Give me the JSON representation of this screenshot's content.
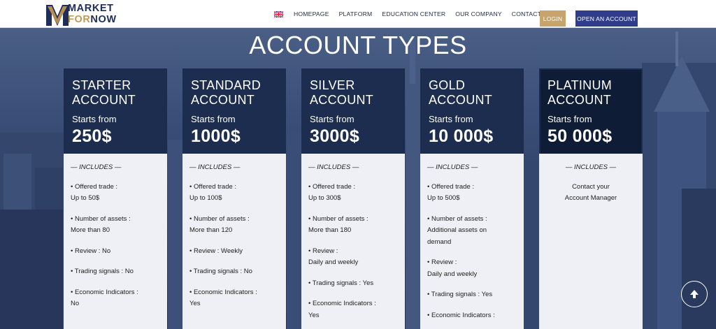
{
  "brand": {
    "line1": "MARKET",
    "line2_a": "FOR",
    "line2_b": "NOW",
    "colors": {
      "navy": "#1f2d5a",
      "gold": "#c49a50"
    }
  },
  "nav": {
    "language_icon": "uk-flag-icon",
    "items": [
      "HOMEPAGE",
      "PLATFORM",
      "EDUCATION CENTER",
      "OUR COMPANY",
      "CONTACT US"
    ],
    "login_label": "LOGIN",
    "open_account_label": "OPEN AN ACCOUNT"
  },
  "page": {
    "title": "ACCOUNT TYPES"
  },
  "cards": [
    {
      "name_line1": "STARTER",
      "name_line2": "ACCOUNT",
      "starts_label": "Starts from",
      "price": "250$",
      "head_color": "#1c2d4f",
      "includes_label": "— INCLUDES —",
      "features": [
        [
          "• Offered trade :",
          "Up to 50$"
        ],
        [
          "• Number of assets :",
          "More than 80"
        ],
        [
          "• Review : No"
        ],
        [
          "• Trading signals : No"
        ],
        [
          "• Economic Indicators :",
          "No"
        ]
      ]
    },
    {
      "name_line1": "STANDARD",
      "name_line2": "ACCOUNT",
      "starts_label": "Starts from",
      "price": "1000$",
      "head_color": "#1c2d4f",
      "includes_label": "— INCLUDES —",
      "features": [
        [
          "• Offered trade :",
          "Up to 100$"
        ],
        [
          "• Number of assets :",
          "More than 120"
        ],
        [
          "• Review : Weekly"
        ],
        [
          "• Trading signals : No"
        ],
        [
          "• Economic Indicators :",
          "Yes"
        ]
      ]
    },
    {
      "name_line1": "SILVER",
      "name_line2": "ACCOUNT",
      "starts_label": "Starts from",
      "price": "3000$",
      "head_color": "#1c2d4f",
      "includes_label": "— INCLUDES —",
      "features": [
        [
          "• Offered trade :",
          "Up to 300$"
        ],
        [
          "• Number of assets :",
          "More than 180"
        ],
        [
          "• Review :",
          "Daily and weekly"
        ],
        [
          "• Trading signals : Yes"
        ],
        [
          "• Economic Indicators :",
          "Yes"
        ]
      ]
    },
    {
      "name_line1": "GOLD",
      "name_line2": "ACCOUNT",
      "starts_label": "Starts from",
      "price": "10 000$",
      "head_color": "#1c2d4f",
      "includes_label": "— INCLUDES —",
      "features": [
        [
          "• Offered trade :",
          "Up to 500$"
        ],
        [
          "• Number of assets :",
          "Additional assets on",
          "demand"
        ],
        [
          "• Review :",
          "Daily and weekly"
        ],
        [
          "• Trading signals : Yes"
        ],
        [
          "• Economic Indicators :"
        ]
      ]
    },
    {
      "name_line1": "PLATINUM",
      "name_line2": "ACCOUNT",
      "starts_label": "Starts from",
      "price": "50 000$",
      "head_color": "#0f1c36",
      "includes_label": "— INCLUDES —",
      "features": [
        [
          "Contact your",
          "Account Manager"
        ]
      ]
    }
  ],
  "scroll_top_icon": "arrow-up-icon"
}
